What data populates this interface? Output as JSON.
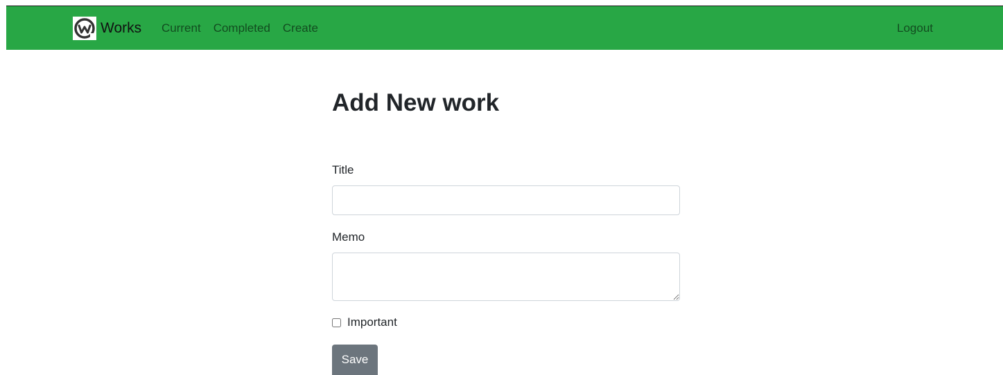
{
  "navbar": {
    "brand_label": "Works",
    "links": [
      {
        "label": "Current"
      },
      {
        "label": "Completed"
      },
      {
        "label": "Create"
      }
    ],
    "logout_label": "Logout",
    "background_color": "#28a745"
  },
  "main": {
    "title": "Add New work",
    "form": {
      "title_label": "Title",
      "title_value": "",
      "memo_label": "Memo",
      "memo_value": "",
      "important_label": "Important",
      "important_checked": false,
      "save_label": "Save"
    }
  },
  "icons": {
    "brand_logo": "workplace-logo-icon"
  }
}
